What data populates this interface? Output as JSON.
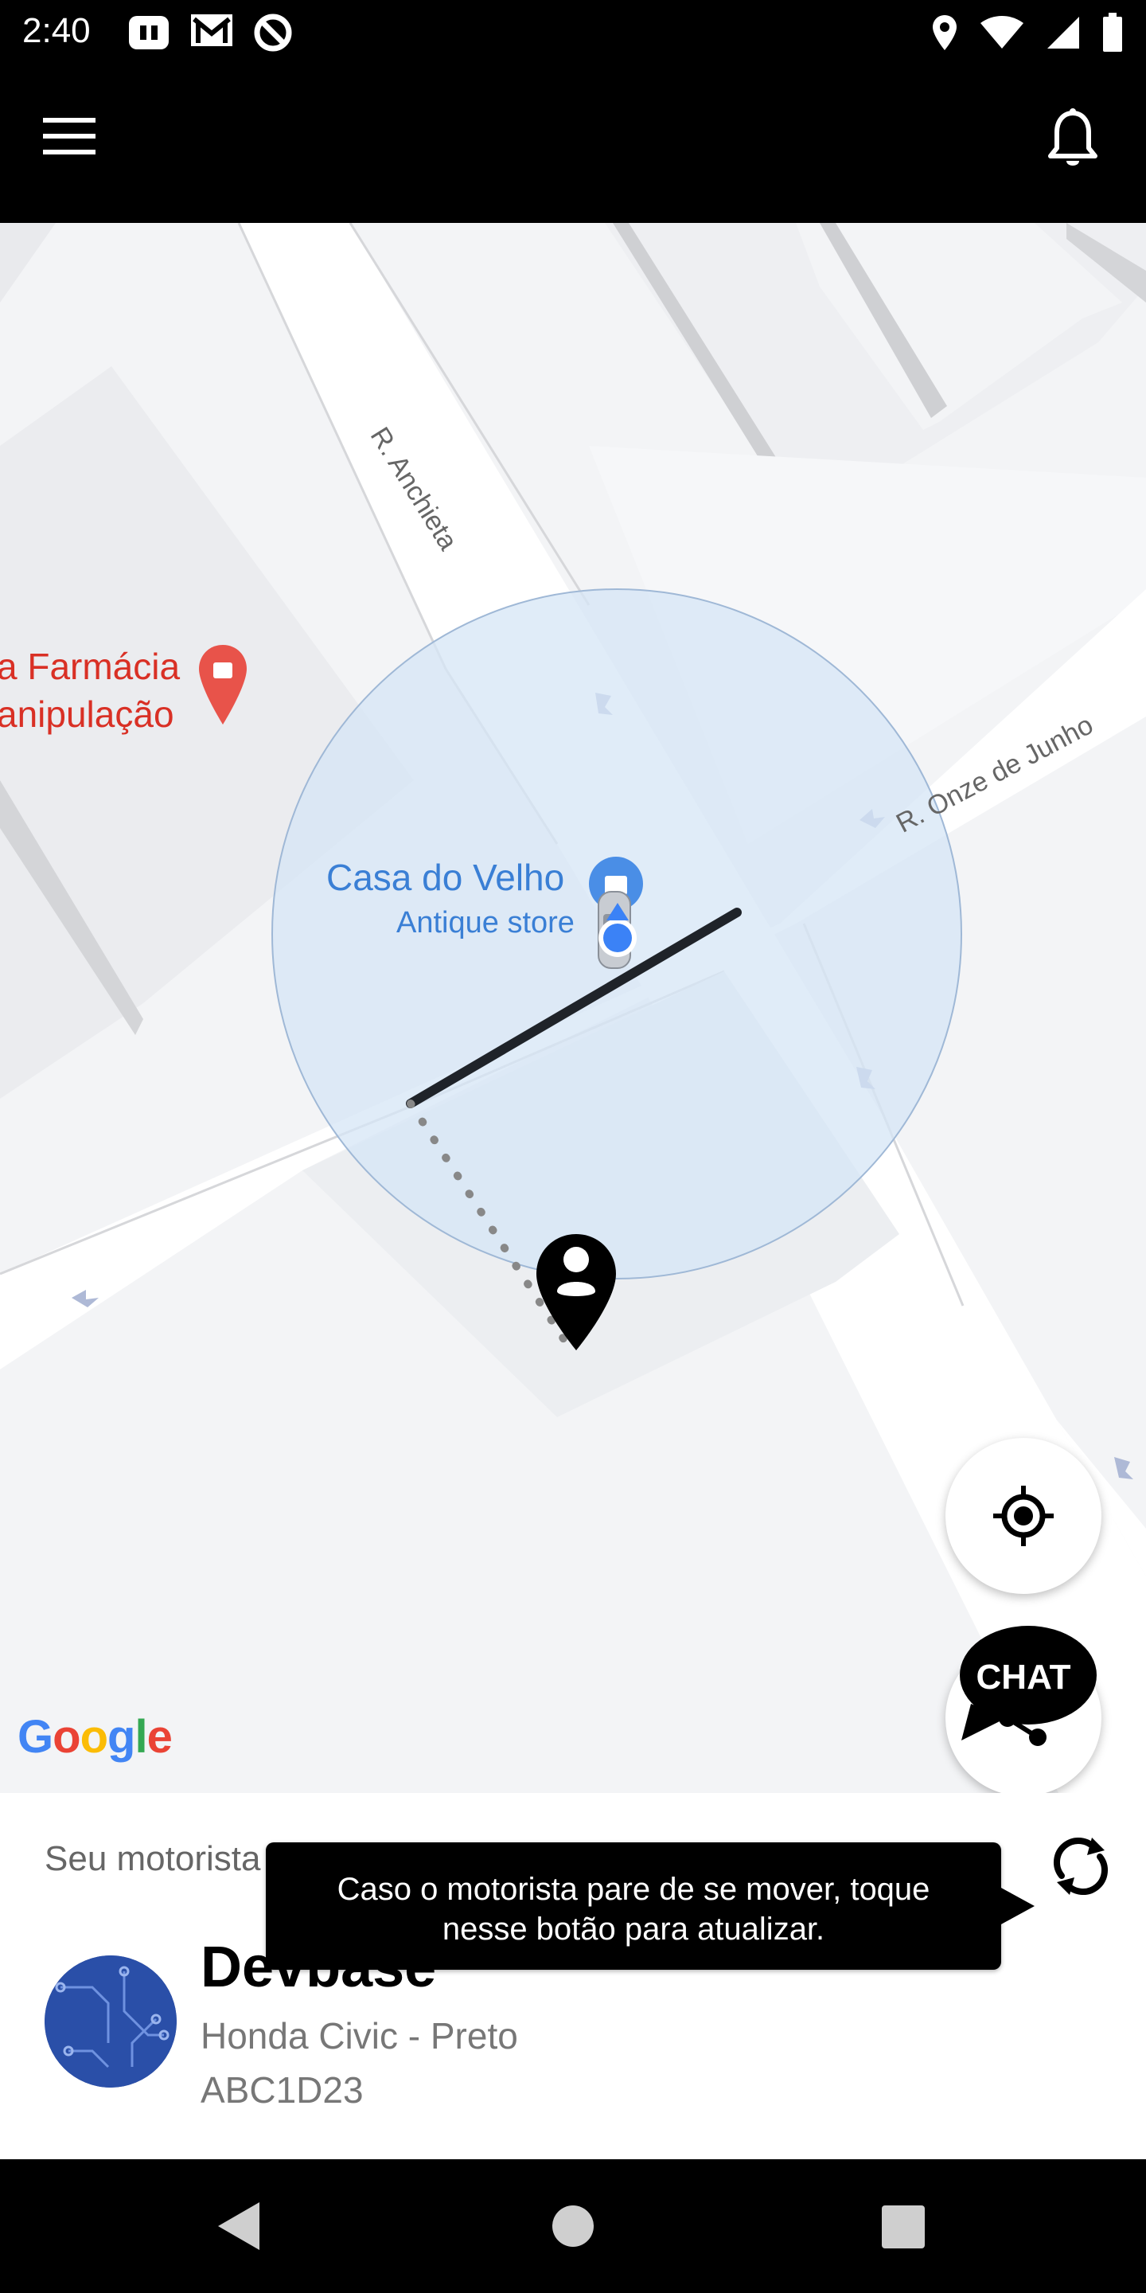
{
  "status_bar": {
    "time": "2:40",
    "left_icons": [
      "app-notification-icon",
      "gmail-icon",
      "data-saver-icon"
    ],
    "right_icons": [
      "location-icon",
      "wifi-icon",
      "signal-icon",
      "battery-icon"
    ]
  },
  "app_bar": {
    "menu_icon": "menu-icon",
    "notifications_icon": "bell-icon"
  },
  "map": {
    "streets": [
      "R. Anchieta",
      "R. Onze de Junho"
    ],
    "poi_farmacia": [
      "a Farmácia",
      "anipulação"
    ],
    "poi_casa_name": "Casa do Velho",
    "poi_casa_type": "Antique store",
    "google_logo": "Google",
    "colors": {
      "accuracy_circle": "#d6e6f6",
      "route": "#1f2329",
      "user_dot": "#3b82f6",
      "poi_red": "#d93025",
      "poi_blue": "#3a7fd5"
    }
  },
  "buttons": {
    "locate_icon": "my-location-icon",
    "share_icon": "share-icon",
    "chat_label": "CHAT"
  },
  "panel": {
    "label": "Seu motorista",
    "tooltip": "Caso o motorista pare de se mover, toque nesse botão para atualizar.",
    "refresh_icon": "refresh-icon",
    "driver": {
      "name": "Devbase",
      "car": "Honda Civic - Preto",
      "plate": "ABC1D23"
    }
  },
  "nav_bar": {
    "back_icon": "back-icon",
    "home_icon": "home-icon",
    "recents_icon": "recents-icon"
  }
}
